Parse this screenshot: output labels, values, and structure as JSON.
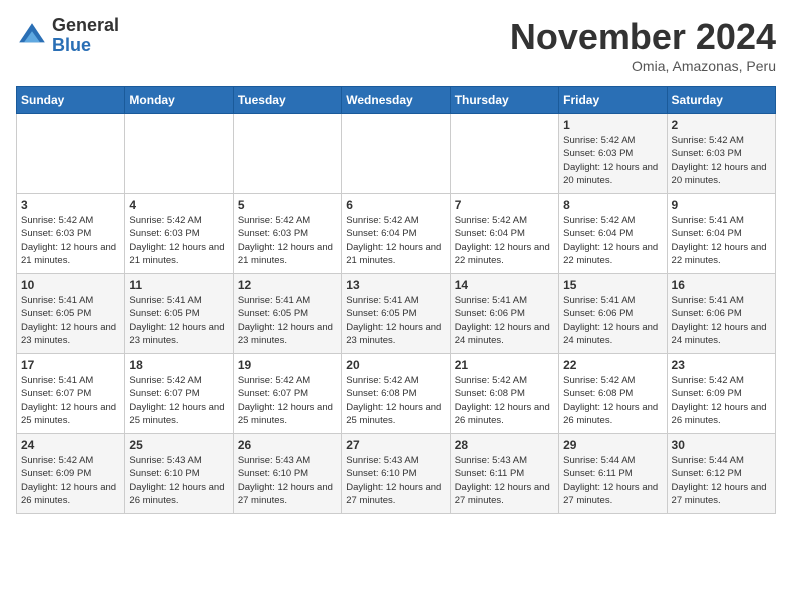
{
  "logo": {
    "general": "General",
    "blue": "Blue"
  },
  "header": {
    "month": "November 2024",
    "location": "Omia, Amazonas, Peru"
  },
  "weekdays": [
    "Sunday",
    "Monday",
    "Tuesday",
    "Wednesday",
    "Thursday",
    "Friday",
    "Saturday"
  ],
  "weeks": [
    [
      {
        "day": "",
        "sunrise": "",
        "sunset": "",
        "daylight": ""
      },
      {
        "day": "",
        "sunrise": "",
        "sunset": "",
        "daylight": ""
      },
      {
        "day": "",
        "sunrise": "",
        "sunset": "",
        "daylight": ""
      },
      {
        "day": "",
        "sunrise": "",
        "sunset": "",
        "daylight": ""
      },
      {
        "day": "",
        "sunrise": "",
        "sunset": "",
        "daylight": ""
      },
      {
        "day": "1",
        "sunrise": "Sunrise: 5:42 AM",
        "sunset": "Sunset: 6:03 PM",
        "daylight": "Daylight: 12 hours and 20 minutes."
      },
      {
        "day": "2",
        "sunrise": "Sunrise: 5:42 AM",
        "sunset": "Sunset: 6:03 PM",
        "daylight": "Daylight: 12 hours and 20 minutes."
      }
    ],
    [
      {
        "day": "3",
        "sunrise": "Sunrise: 5:42 AM",
        "sunset": "Sunset: 6:03 PM",
        "daylight": "Daylight: 12 hours and 21 minutes."
      },
      {
        "day": "4",
        "sunrise": "Sunrise: 5:42 AM",
        "sunset": "Sunset: 6:03 PM",
        "daylight": "Daylight: 12 hours and 21 minutes."
      },
      {
        "day": "5",
        "sunrise": "Sunrise: 5:42 AM",
        "sunset": "Sunset: 6:03 PM",
        "daylight": "Daylight: 12 hours and 21 minutes."
      },
      {
        "day": "6",
        "sunrise": "Sunrise: 5:42 AM",
        "sunset": "Sunset: 6:04 PM",
        "daylight": "Daylight: 12 hours and 21 minutes."
      },
      {
        "day": "7",
        "sunrise": "Sunrise: 5:42 AM",
        "sunset": "Sunset: 6:04 PM",
        "daylight": "Daylight: 12 hours and 22 minutes."
      },
      {
        "day": "8",
        "sunrise": "Sunrise: 5:42 AM",
        "sunset": "Sunset: 6:04 PM",
        "daylight": "Daylight: 12 hours and 22 minutes."
      },
      {
        "day": "9",
        "sunrise": "Sunrise: 5:41 AM",
        "sunset": "Sunset: 6:04 PM",
        "daylight": "Daylight: 12 hours and 22 minutes."
      }
    ],
    [
      {
        "day": "10",
        "sunrise": "Sunrise: 5:41 AM",
        "sunset": "Sunset: 6:05 PM",
        "daylight": "Daylight: 12 hours and 23 minutes."
      },
      {
        "day": "11",
        "sunrise": "Sunrise: 5:41 AM",
        "sunset": "Sunset: 6:05 PM",
        "daylight": "Daylight: 12 hours and 23 minutes."
      },
      {
        "day": "12",
        "sunrise": "Sunrise: 5:41 AM",
        "sunset": "Sunset: 6:05 PM",
        "daylight": "Daylight: 12 hours and 23 minutes."
      },
      {
        "day": "13",
        "sunrise": "Sunrise: 5:41 AM",
        "sunset": "Sunset: 6:05 PM",
        "daylight": "Daylight: 12 hours and 23 minutes."
      },
      {
        "day": "14",
        "sunrise": "Sunrise: 5:41 AM",
        "sunset": "Sunset: 6:06 PM",
        "daylight": "Daylight: 12 hours and 24 minutes."
      },
      {
        "day": "15",
        "sunrise": "Sunrise: 5:41 AM",
        "sunset": "Sunset: 6:06 PM",
        "daylight": "Daylight: 12 hours and 24 minutes."
      },
      {
        "day": "16",
        "sunrise": "Sunrise: 5:41 AM",
        "sunset": "Sunset: 6:06 PM",
        "daylight": "Daylight: 12 hours and 24 minutes."
      }
    ],
    [
      {
        "day": "17",
        "sunrise": "Sunrise: 5:41 AM",
        "sunset": "Sunset: 6:07 PM",
        "daylight": "Daylight: 12 hours and 25 minutes."
      },
      {
        "day": "18",
        "sunrise": "Sunrise: 5:42 AM",
        "sunset": "Sunset: 6:07 PM",
        "daylight": "Daylight: 12 hours and 25 minutes."
      },
      {
        "day": "19",
        "sunrise": "Sunrise: 5:42 AM",
        "sunset": "Sunset: 6:07 PM",
        "daylight": "Daylight: 12 hours and 25 minutes."
      },
      {
        "day": "20",
        "sunrise": "Sunrise: 5:42 AM",
        "sunset": "Sunset: 6:08 PM",
        "daylight": "Daylight: 12 hours and 25 minutes."
      },
      {
        "day": "21",
        "sunrise": "Sunrise: 5:42 AM",
        "sunset": "Sunset: 6:08 PM",
        "daylight": "Daylight: 12 hours and 26 minutes."
      },
      {
        "day": "22",
        "sunrise": "Sunrise: 5:42 AM",
        "sunset": "Sunset: 6:08 PM",
        "daylight": "Daylight: 12 hours and 26 minutes."
      },
      {
        "day": "23",
        "sunrise": "Sunrise: 5:42 AM",
        "sunset": "Sunset: 6:09 PM",
        "daylight": "Daylight: 12 hours and 26 minutes."
      }
    ],
    [
      {
        "day": "24",
        "sunrise": "Sunrise: 5:42 AM",
        "sunset": "Sunset: 6:09 PM",
        "daylight": "Daylight: 12 hours and 26 minutes."
      },
      {
        "day": "25",
        "sunrise": "Sunrise: 5:43 AM",
        "sunset": "Sunset: 6:10 PM",
        "daylight": "Daylight: 12 hours and 26 minutes."
      },
      {
        "day": "26",
        "sunrise": "Sunrise: 5:43 AM",
        "sunset": "Sunset: 6:10 PM",
        "daylight": "Daylight: 12 hours and 27 minutes."
      },
      {
        "day": "27",
        "sunrise": "Sunrise: 5:43 AM",
        "sunset": "Sunset: 6:10 PM",
        "daylight": "Daylight: 12 hours and 27 minutes."
      },
      {
        "day": "28",
        "sunrise": "Sunrise: 5:43 AM",
        "sunset": "Sunset: 6:11 PM",
        "daylight": "Daylight: 12 hours and 27 minutes."
      },
      {
        "day": "29",
        "sunrise": "Sunrise: 5:44 AM",
        "sunset": "Sunset: 6:11 PM",
        "daylight": "Daylight: 12 hours and 27 minutes."
      },
      {
        "day": "30",
        "sunrise": "Sunrise: 5:44 AM",
        "sunset": "Sunset: 6:12 PM",
        "daylight": "Daylight: 12 hours and 27 minutes."
      }
    ]
  ]
}
